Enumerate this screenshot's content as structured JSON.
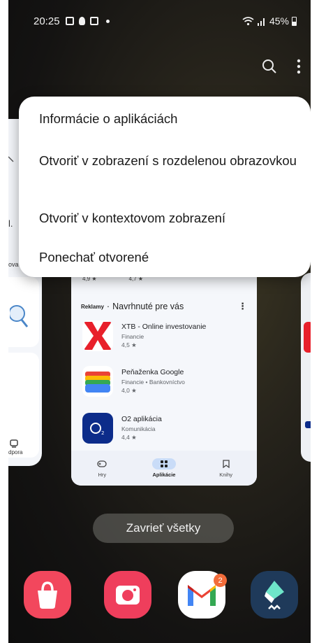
{
  "status_bar": {
    "time": "20:25",
    "battery": "45%",
    "notification_icons": [
      "gallery-icon",
      "bulb-icon",
      "app-icon",
      "dot-icon"
    ],
    "signal_icons": [
      "wifi-icon",
      "signal-icon"
    ]
  },
  "context_menu": {
    "items": [
      "Informácie o aplikáciách",
      "Otvoriť v zobrazení s rozdelenou obrazovkou",
      "Otvoriť v kontextovom zobrazení",
      "Ponechať otvorené"
    ]
  },
  "left_card": {
    "fragments": [
      "l.",
      "ova",
      "dpora"
    ]
  },
  "app_card": {
    "ratings": [
      "4,9 ★",
      "4,7 ★"
    ],
    "section_ads": "Reklamy",
    "section_sep": "·",
    "section_title": "Navrhnuté pre vás",
    "section_more": "⋮",
    "apps": [
      {
        "name": "XTB - Online investovanie",
        "category": "Financie",
        "rating": "4,5 ★"
      },
      {
        "name": "Peňaženka Google",
        "category": "Financie • Bankovníctvo",
        "rating": "4,0 ★"
      },
      {
        "name": "O2 aplikácia",
        "category": "Komunikácia",
        "rating": "4,4 ★"
      }
    ],
    "nav": [
      {
        "label": "Hry",
        "icon": "gamepad-icon"
      },
      {
        "label": "Aplikácie",
        "icon": "apps-icon"
      },
      {
        "label": "Knihy",
        "icon": "bookmark-icon"
      }
    ]
  },
  "close_all_label": "Zavrieť všetky",
  "dock": {
    "apps": [
      "galaxy-store-icon",
      "camera-icon",
      "gmail-icon",
      "filmora-icon"
    ],
    "gmail_badge": "2"
  },
  "colors": {
    "menu_background": "#ffffff",
    "active_nav_pill": "#c9dcf8",
    "xtb_red": "#e8202b",
    "o2_blue": "#0c2c8a",
    "badge": "#f26c3a"
  }
}
